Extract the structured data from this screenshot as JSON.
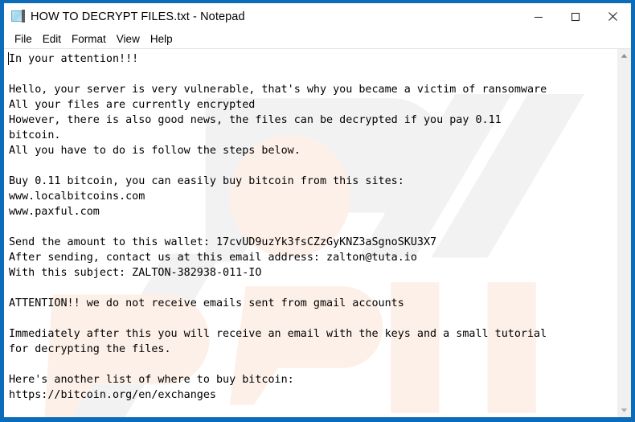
{
  "window": {
    "title": "HOW TO DECRYPT FILES.txt - Notepad",
    "icon": "notepad-document-icon",
    "border_color": "#0d6cb9",
    "background_color": "#ffffff"
  },
  "window_controls": {
    "minimize": {
      "label": "Minimize",
      "icon": "minimize-icon"
    },
    "maximize": {
      "label": "Maximize",
      "icon": "maximize-icon"
    },
    "close": {
      "label": "Close",
      "icon": "close-icon"
    }
  },
  "menu_bar": {
    "items": [
      {
        "label": "File"
      },
      {
        "label": "Edit"
      },
      {
        "label": "Format"
      },
      {
        "label": "View"
      },
      {
        "label": "Help"
      }
    ]
  },
  "editor": {
    "caret_visible": true,
    "text_color": "#000000",
    "body": "In your attention!!!\n\nHello, your server is very vulnerable, that's why you became a victim of ransomware\nAll your files are currently encrypted\nHowever, there is also good news, the files can be decrypted if you pay 0.11\nbitcoin.\nAll you have to do is follow the steps below.\n\nBuy 0.11 bitcoin, you can easily buy bitcoin from this sites:\nwww.localbitcoins.com\nwww.paxful.com\n\nSend the amount to this wallet: 17cvUD9uzYk3fsCZzGyKNZ3aSgnoSKU3X7\nAfter sending, contact us at this email address: zalton@tuta.io\nWith this subject: ZALTON-382938-011-IO\n\nATTENTION!! we do not receive emails sent from gmail accounts\n\nImmediately after this you will receive an email with the keys and a small tutorial\nfor decrypting the files.\n\nHere's another list of where to buy bitcoin:\nhttps://bitcoin.org/en/exchanges",
    "ransom_details": {
      "ransom_amount": "0.11",
      "currency": "bitcoin",
      "wallet_address": "17cvUD9uzYk3fsCZzGyKNZ3aSgnoSKU3X7",
      "contact_email": "zalton@tuta.io",
      "email_subject": "ZALTON-382938-011-IO",
      "purchase_sites": [
        "www.localbitcoins.com",
        "www.paxful.com"
      ],
      "exchange_list_url": "https://bitcoin.org/en/exchanges"
    }
  },
  "scrollbar": {
    "up_arrow": "scroll-up-icon",
    "down_arrow": "scroll-down-icon"
  }
}
